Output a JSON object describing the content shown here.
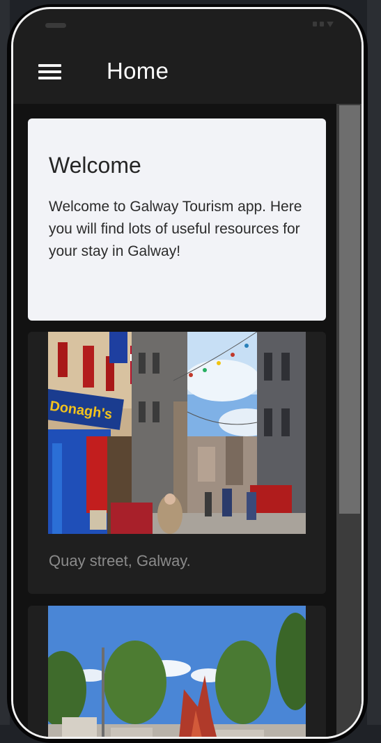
{
  "app_bar": {
    "title": "Home",
    "menu_icon": "hamburger-menu-icon"
  },
  "welcome_card": {
    "title": "Welcome",
    "body": "Welcome to Galway Tourism app. Here you will find lots of useful resources for your stay in Galway!"
  },
  "photo_cards": [
    {
      "image": "galway-quay-street-photo",
      "caption": "Quay street, Galway."
    },
    {
      "image": "galway-square-sculpture-photo",
      "caption": ""
    }
  ],
  "colors": {
    "app_bar": "#1e1e1e",
    "welcome_card": "#f2f3f7",
    "caption_text": "#8b8b8b",
    "phone_frame": "#f2f2f2"
  }
}
